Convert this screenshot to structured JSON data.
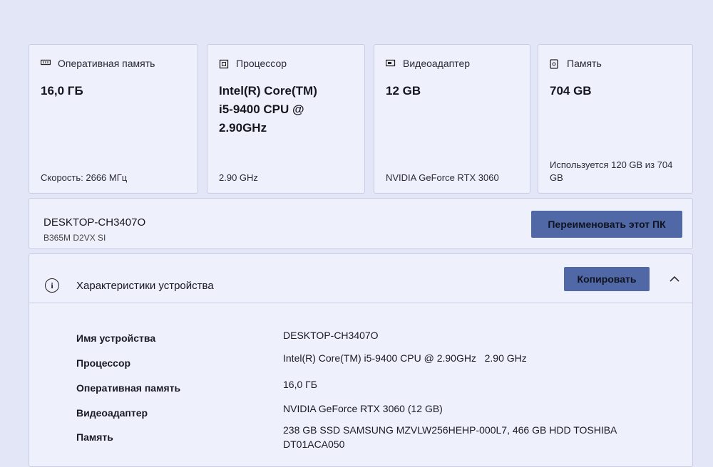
{
  "cards": {
    "ram": {
      "title": "Оперативная память",
      "value": "16,0 ГБ",
      "footer": "Скорость: 2666 МГц",
      "icon": "ram-icon"
    },
    "cpu": {
      "title": "Процессор",
      "value_line1": "Intel(R) Core(TM)",
      "value_line2": "i5-9400 CPU @",
      "value_line3": "2.90GHz",
      "footer": "2.90 GHz",
      "icon": "cpu-icon"
    },
    "gpu": {
      "title": "Видеоадаптер",
      "value": "12 GB",
      "footer": "NVIDIA GeForce RTX 3060",
      "icon": "gpu-icon"
    },
    "storage": {
      "title": "Память",
      "value": "704 GB",
      "footer_line1": "Используется 120 GB из 704",
      "footer_line2": "GB",
      "icon": "storage-icon"
    }
  },
  "device": {
    "name": "DESKTOP-CH3407O",
    "model": "B365M D2VX SI",
    "rename_button": "Переименовать этот ПК"
  },
  "specs": {
    "title": "Характеристики устройства",
    "copy_button": "Копировать",
    "rows": [
      {
        "label": "Имя устройства",
        "value": "DESKTOP-CH3407O"
      },
      {
        "label": "Процессор",
        "value": "Intel(R) Core(TM) i5-9400 CPU @ 2.90GHz   2.90 GHz"
      },
      {
        "label": "Оперативная память",
        "value": "16,0 ГБ"
      },
      {
        "label": "Видеоадаптер",
        "value": "NVIDIA GeForce RTX 3060 (12 GB)"
      },
      {
        "label": "Память",
        "value_line1": "238 GB SSD SAMSUNG MZVLW256HEHP-000L7, 466 GB HDD TOSHIBA",
        "value_line2": "DT01ACA050"
      }
    ]
  },
  "colors": {
    "accent_button": "#5069a6",
    "card_bg": "#eef0fb",
    "page_bg": "#e3e6f6"
  }
}
